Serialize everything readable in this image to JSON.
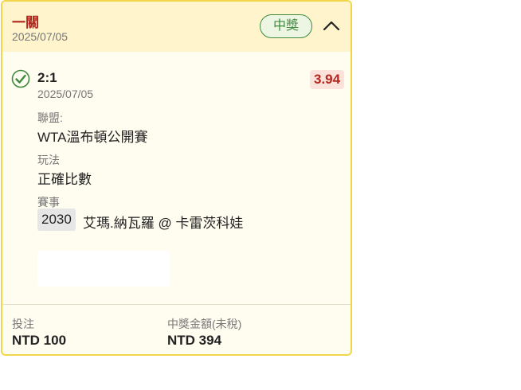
{
  "header": {
    "bet_type": "一關",
    "date": "2025/07/05",
    "result_badge": "中獎"
  },
  "selection": {
    "score": "2:1",
    "date": "2025/07/05",
    "odds": "3.94",
    "league_label": "聯盟:",
    "league": "WTA溫布頓公開賽",
    "play_label": "玩法",
    "play": "正確比數",
    "event_label": "賽事",
    "match_code": "2030",
    "match_name": "艾瑪.納瓦羅 @ 卡雷茨科娃"
  },
  "footer": {
    "stake_label": "投注",
    "stake_value": "NTD 100",
    "payout_label": "中獎金額(未稅)",
    "payout_value": "NTD 394"
  },
  "colors": {
    "accent_red": "#b3261e",
    "win_green": "#3e8a3e",
    "border_yellow": "#f2d64a"
  },
  "icons": {
    "check": "check-circle-icon",
    "collapse": "chevron-up-icon"
  }
}
